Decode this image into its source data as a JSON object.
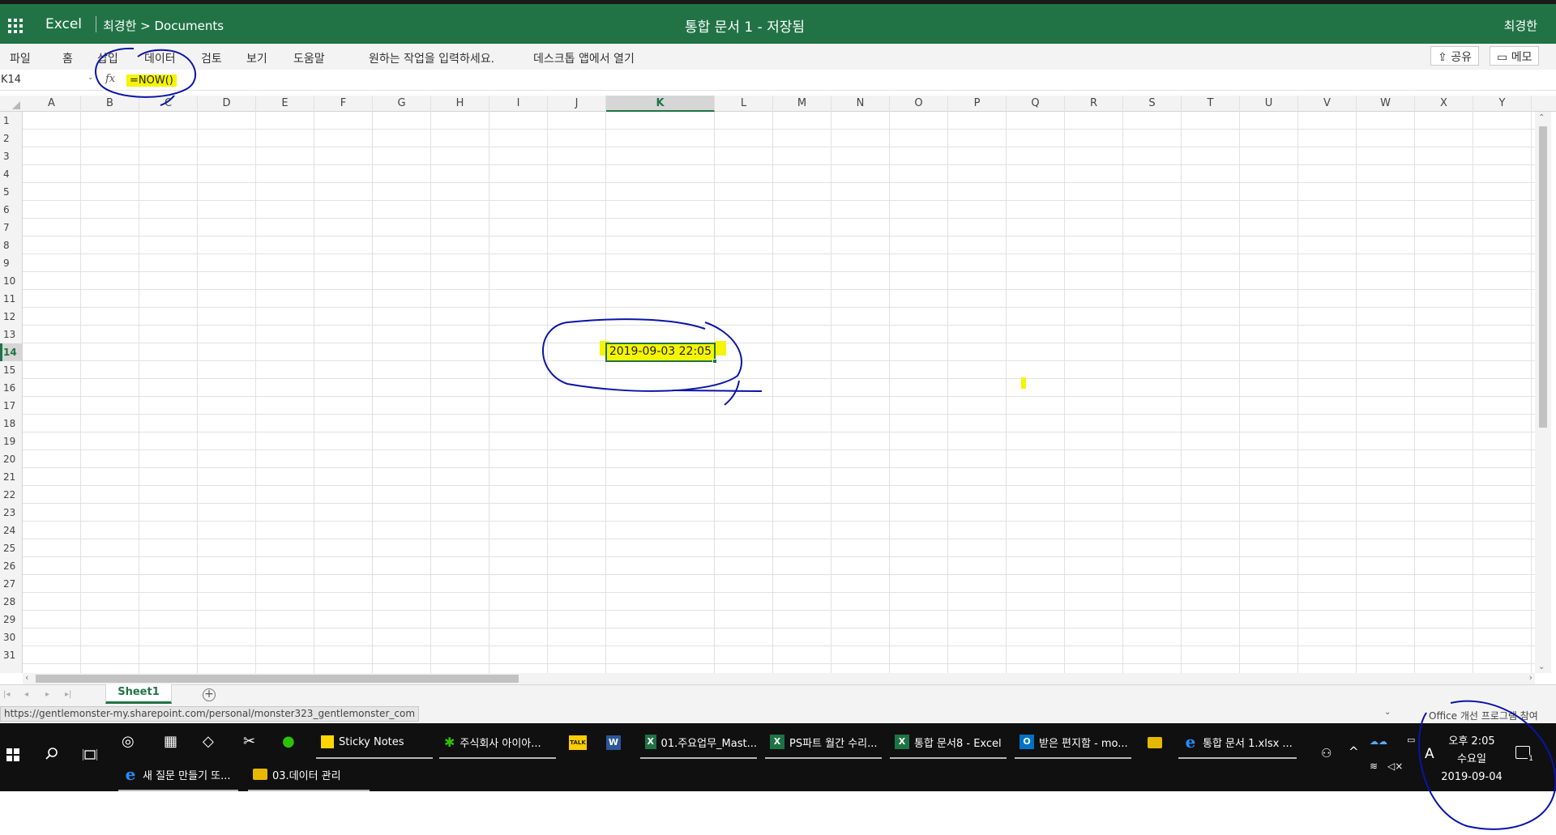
{
  "header": {
    "app_name": "Excel",
    "breadcrumb": "최경한 > Documents",
    "doc_title": "통합 문서 1  -   저장됨",
    "user_name": "최경한"
  },
  "ribbon": {
    "tabs": [
      "파일",
      "홈",
      "삽입",
      "데이터",
      "검토",
      "보기",
      "도움말"
    ],
    "tell_me": "원하는 작업을 입력하세요.",
    "open_desktop": "데스크톱 앱에서 열기",
    "share": "공유",
    "comments": "메모"
  },
  "formula_bar": {
    "name_box": "K14",
    "fx": "fx",
    "formula": "=NOW()"
  },
  "grid": {
    "columns": [
      "A",
      "B",
      "C",
      "D",
      "E",
      "F",
      "G",
      "H",
      "I",
      "J",
      "K",
      "L",
      "M",
      "N",
      "O",
      "P",
      "Q",
      "R",
      "S",
      "T",
      "U",
      "V",
      "W",
      "X",
      "Y"
    ],
    "active_column": "K",
    "active_row": 14,
    "rows": [
      "1",
      "2",
      "3",
      "4",
      "5",
      "6",
      "7",
      "8",
      "9",
      "10",
      "11",
      "12",
      "13",
      "14",
      "15",
      "16",
      "17",
      "18",
      "19",
      "20",
      "21",
      "22",
      "23",
      "24",
      "25",
      "26",
      "27",
      "28",
      "29",
      "30",
      "31"
    ],
    "cell_k14": "2019-09-03 22:05"
  },
  "sheets": {
    "active": "Sheet1",
    "add_label": "+"
  },
  "status_bar": {
    "url": "https://gentlemonster-my.sharepoint.com/personal/monster323_gentlemonster_com",
    "right_text": "Office 개선 프로그램 참여"
  },
  "taskbar": {
    "items": [
      {
        "label": "Sticky Notes"
      },
      {
        "label": "주식회사 아이아..."
      },
      {
        "label": "01.주요업무_Mast..."
      },
      {
        "label": "PS파트 월간 수리..."
      },
      {
        "label": "통합 문서8 - Excel"
      },
      {
        "label": "받은 편지함 - mo..."
      },
      {
        "label": "통합 문서 1.xlsx ..."
      },
      {
        "label": "새 질문 만들기 또..."
      },
      {
        "label": "03.데이터 관리"
      }
    ],
    "badge_talk": "TALK",
    "ime": "A",
    "time": "오후 2:05",
    "weekday": "수요일",
    "date": "2019-09-04",
    "notification_count": "1"
  },
  "colors": {
    "excel_green": "#217346",
    "highlight_yellow": "#f5f500",
    "annotation_blue": "#0a14a8"
  }
}
